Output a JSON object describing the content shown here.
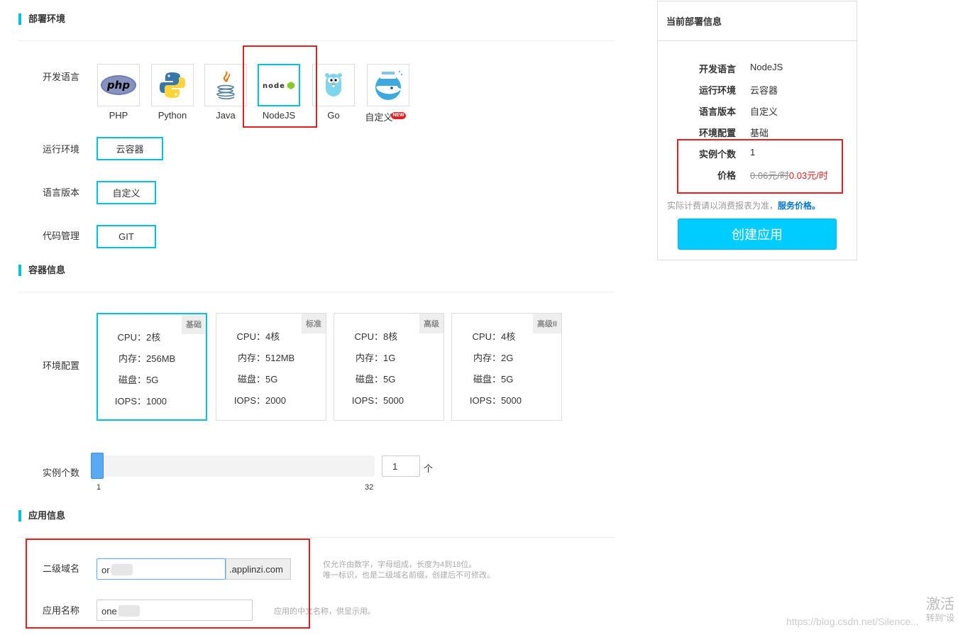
{
  "sections": {
    "deploy_env": "部署环境",
    "container_info": "容器信息",
    "app_info": "应用信息"
  },
  "labels": {
    "dev_language": "开发语言",
    "runtime_env": "运行环境",
    "lang_version": "语言版本",
    "code_mgmt": "代码管理",
    "env_config": "环境配置",
    "instance_count": "实例个数",
    "subdomain": "二级域名",
    "app_name": "应用名称"
  },
  "languages": [
    {
      "name": "PHP",
      "icon": "php-logo-icon"
    },
    {
      "name": "Python",
      "icon": "python-logo-icon"
    },
    {
      "name": "Java",
      "icon": "java-logo-icon"
    },
    {
      "name": "NodeJS",
      "icon": "nodejs-logo-icon",
      "selected": true
    },
    {
      "name": "Go",
      "icon": "go-gopher-icon"
    },
    {
      "name": "自定义",
      "icon": "docker-whale-icon",
      "badge": "NEW"
    }
  ],
  "options": {
    "runtime": "云容器",
    "version": "自定义",
    "code": "GIT"
  },
  "specs": [
    {
      "tag": "基础",
      "cpu": "2核",
      "mem": "256MB",
      "disk": "5G",
      "iops": "1000",
      "selected": true
    },
    {
      "tag": "标准",
      "cpu": "4核",
      "mem": "512MB",
      "disk": "5G",
      "iops": "2000"
    },
    {
      "tag": "高级",
      "cpu": "8核",
      "mem": "1G",
      "disk": "5G",
      "iops": "5000"
    },
    {
      "tag": "高级II",
      "cpu": "4核",
      "mem": "2G",
      "disk": "5G",
      "iops": "5000"
    }
  ],
  "spec_keys": {
    "cpu": "CPU：",
    "mem": "内存：",
    "disk": "磁盘：",
    "iops": "IOPS："
  },
  "slider": {
    "min": "1",
    "max": "32",
    "value": "1",
    "unit": "个",
    "fraction": 0.0
  },
  "app": {
    "subdomain_value": "or",
    "subdomain_suffix": ".applinzi.com",
    "subdomain_hint_1": "仅允许由数字，字母组成，长度为4到18位。",
    "subdomain_hint_2": "唯一标识，也是二级域名前缀，创建后不可修改。",
    "name_value": "one",
    "name_hint": "应用的中文名称，供显示用。"
  },
  "summary": {
    "title": "当前部署信息",
    "rows": [
      {
        "k": "开发语言",
        "v": "NodeJS"
      },
      {
        "k": "运行环境",
        "v": "云容器"
      },
      {
        "k": "语言版本",
        "v": "自定义"
      },
      {
        "k": "环境配置",
        "v": "基础"
      },
      {
        "k": "实例个数",
        "v": "1"
      }
    ],
    "price_label": "价格",
    "price_old": "0.06元/时",
    "price_new": "0.03元/时",
    "note": "实际计费请以消费报表为准，",
    "note_link": "服务价格。",
    "create_button": "创建应用"
  },
  "watermark": {
    "activate": "激活",
    "goto": "转到\"设",
    "url": "https://blog.csdn.net/Silence..."
  },
  "colors": {
    "accent": "#00c1de",
    "highlight": "#e02020",
    "price_red": "#e02020",
    "link": "#0077cc"
  }
}
